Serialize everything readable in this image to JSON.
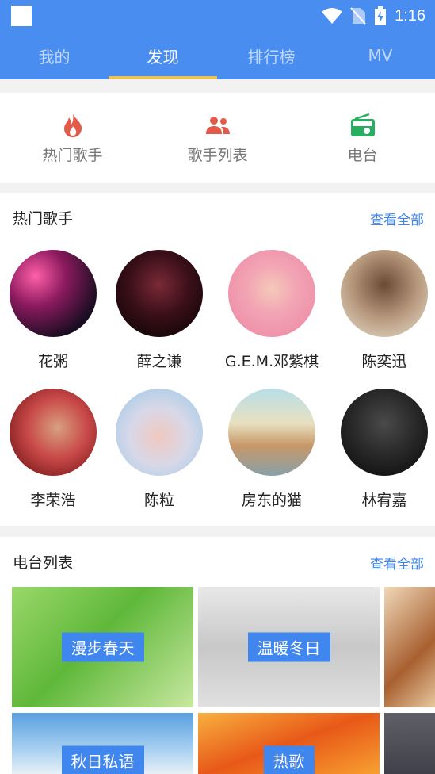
{
  "status": {
    "time": "1:16"
  },
  "tabs": [
    {
      "label": "我的"
    },
    {
      "label": "发现"
    },
    {
      "label": "排行榜"
    },
    {
      "label": "MV"
    }
  ],
  "quicknav": [
    {
      "label": "热门歌手",
      "icon": "fire-icon",
      "color": "#e25b4a"
    },
    {
      "label": "歌手列表",
      "icon": "people-icon",
      "color": "#e25b4a"
    },
    {
      "label": "电台",
      "icon": "radio-icon",
      "color": "#27ae60"
    }
  ],
  "hot_artists": {
    "title": "热门歌手",
    "more": "查看全部",
    "items": [
      {
        "name": "花粥"
      },
      {
        "name": "薛之谦"
      },
      {
        "name": "G.E.M.邓紫棋"
      },
      {
        "name": "陈奕迅"
      },
      {
        "name": "李荣浩"
      },
      {
        "name": "陈粒"
      },
      {
        "name": "房东的猫"
      },
      {
        "name": "林宥嘉"
      }
    ]
  },
  "radio": {
    "title": "电台列表",
    "more": "查看全部",
    "items": [
      {
        "label": "漫步春天"
      },
      {
        "label": "温暖冬日"
      },
      {
        "label": ""
      },
      {
        "label": "秋日私语"
      },
      {
        "label": "热歌"
      },
      {
        "label": ""
      }
    ]
  },
  "colors": {
    "primary": "#4a8df0",
    "indicator": "#e8c25a",
    "link": "#3f86ee"
  }
}
